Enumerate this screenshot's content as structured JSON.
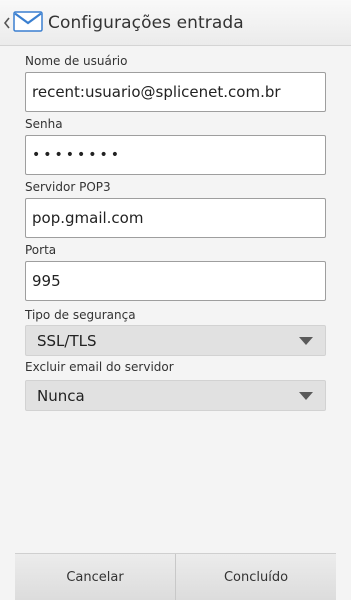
{
  "header": {
    "title": "Configurações entrada",
    "back_icon": "chevron-left-icon",
    "app_icon": "mail-envelope-icon"
  },
  "form": {
    "username": {
      "label": "Nome de usuário",
      "value": "recent:usuario@splicenet.com.br"
    },
    "password": {
      "label": "Senha",
      "value": "••••••••"
    },
    "pop3_server": {
      "label": "Servidor POP3",
      "value": "pop.gmail.com"
    },
    "port": {
      "label": "Porta",
      "value": "995"
    },
    "security_type": {
      "label": "Tipo de segurança",
      "value": "SSL/TLS"
    },
    "delete_from_server": {
      "label": "Excluir email do servidor",
      "value": "Nunca"
    }
  },
  "actions": {
    "cancel_label": "Cancelar",
    "done_label": "Concluído"
  },
  "colors": {
    "envelope_blue": "#3a7fd0",
    "select_bg": "#e1e1e1"
  }
}
